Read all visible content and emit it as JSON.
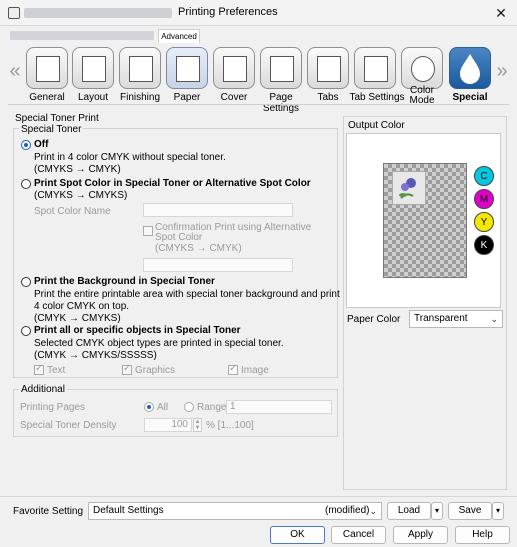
{
  "window": {
    "title": "Printing Preferences",
    "close": "✕"
  },
  "tabs": {
    "advanced": "Advanced"
  },
  "toolbar": {
    "prev_arrow": "«",
    "next_arrow": "»",
    "items": [
      {
        "label": "General"
      },
      {
        "label": "Layout"
      },
      {
        "label": "Finishing"
      },
      {
        "label": "Paper"
      },
      {
        "label": "Cover"
      },
      {
        "label": "Page Settings"
      },
      {
        "label": "Tabs"
      },
      {
        "label": "Tab Settings"
      },
      {
        "label": "Color Mode"
      },
      {
        "label": "Special"
      }
    ]
  },
  "special": {
    "section_title": "Special Toner Print",
    "group_title": "Special Toner",
    "off_label": "Off",
    "off_desc1": "Print in 4 color CMYK without special toner.",
    "off_desc2": "(CMYKS → CMYK)",
    "spot_label": "Print Spot Color in Special Toner or Alternative Spot Color",
    "spot_desc": "(CMYKS → CMYKS)",
    "spot_name_label": "Spot Color Name",
    "confirm_label": "Confirmation Print using Alternative Spot Color",
    "confirm_desc": "(CMYKS → CMYK)",
    "background_label": "Print the Background in Special Toner",
    "background_desc1": "Print the entire printable area with special toner background and print",
    "background_desc2": "4 color CMYK on top.",
    "background_desc3": "(CMYK → CMYKS)",
    "objects_label": "Print all or specific objects in Special Toner",
    "objects_desc1": "Selected CMYK object types are printed in special toner.",
    "objects_desc2": "(CMYK → CMYKS/SSSSS)",
    "text_label": "Text",
    "graphics_label": "Graphics",
    "image_label": "Image"
  },
  "additional": {
    "title": "Additional",
    "pages_label": "Printing Pages",
    "all_label": "All",
    "range_label": "Range",
    "range_value": "1",
    "density_label": "Special Toner Density",
    "density_value": "100",
    "density_unit": "% [1...100]"
  },
  "output": {
    "title": "Output Color",
    "inks": [
      "C",
      "M",
      "Y",
      "K"
    ],
    "ink_colors": [
      "#00c8e0",
      "#e000c8",
      "#f5e800",
      "#000000"
    ],
    "paper_color_label": "Paper Color",
    "paper_color_value": "Transparent"
  },
  "footer": {
    "favorite_label": "Favorite Setting",
    "favorite_value": "Default Settings",
    "favorite_state": "(modified)",
    "load_label": "Load",
    "save_label": "Save",
    "ok_label": "OK",
    "cancel_label": "Cancel",
    "apply_label": "Apply",
    "help_label": "Help"
  }
}
